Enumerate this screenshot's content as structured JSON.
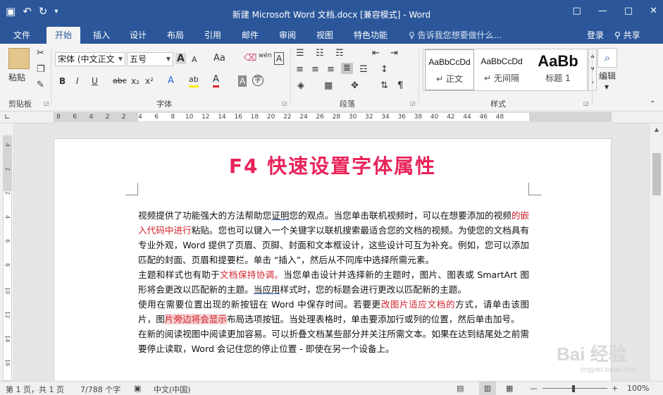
{
  "window": {
    "title": "新建 Microsoft Word 文档.docx [兼容模式] - Word",
    "controls": [
      "□",
      "—",
      "□",
      "✕"
    ]
  },
  "quick_access": {
    "save_icon": "▣",
    "undo_icon": "↶",
    "redo_icon": "↻",
    "customize_icon": "▾"
  },
  "tabs": [
    {
      "label": "文件"
    },
    {
      "label": "开始"
    },
    {
      "label": "插入"
    },
    {
      "label": "设计"
    },
    {
      "label": "布局"
    },
    {
      "label": "引用"
    },
    {
      "label": "邮件"
    },
    {
      "label": "审阅"
    },
    {
      "label": "视图"
    },
    {
      "label": "特色功能"
    }
  ],
  "active_tab": "开始",
  "tell_me": "♀ 告诉我您想要做什么...",
  "account": {
    "login": "登录",
    "share": "共享"
  },
  "ribbon": {
    "clipboard": {
      "paste": "粘贴",
      "label": "剪贴板"
    },
    "font": {
      "font_name": "宋体 (中文正文",
      "font_size": "五号",
      "grow": "A",
      "shrink": "A",
      "case": "Aa",
      "wen": "wén",
      "bold": "B",
      "italic": "I",
      "underline": "U",
      "strike": "abc",
      "subscript": "x₂",
      "superscript": "x²",
      "highlight": "ab",
      "font_color": "A",
      "shading": "A",
      "enclose": "字",
      "label": "字体"
    },
    "paragraph": {
      "label": "段落"
    },
    "styles": {
      "items": [
        {
          "sample": "AaBbCcDd",
          "name": "↵ 正文"
        },
        {
          "sample": "AaBbCcDd",
          "name": "↵ 无间隔"
        },
        {
          "sample": "AaBb",
          "name": "标题 1"
        }
      ],
      "label": "样式"
    },
    "editing": {
      "label": "编辑"
    }
  },
  "ruler": {
    "ticks": [
      "8",
      "6",
      "4",
      "2",
      "2",
      "4",
      "6",
      "8",
      "10",
      "12",
      "14",
      "16",
      "18",
      "20",
      "22",
      "24",
      "26",
      "28",
      "30",
      "32",
      "34",
      "36",
      "38",
      "40",
      "42",
      "44",
      "46",
      "48"
    ],
    "vticks": [
      "4",
      "2",
      "2",
      "4",
      "6",
      "8",
      "10",
      "12",
      "14",
      "16"
    ]
  },
  "document": {
    "heading": "F4  快速设置字体属性",
    "paragraphs": [
      [
        {
          "t": "视频提供了功能强大的方法帮助您"
        },
        {
          "t": "证明",
          "s": "uline"
        },
        {
          "t": "您的观点。当您单击联机视频时，可以在想要添加的视频"
        },
        {
          "t": "的嵌入代码中进行",
          "s": "red"
        },
        {
          "t": "粘贴。您也可以键入一个关键字以联机搜索最适合您的文档的视频。为使您的文档具有专业外观，Word 提供了页眉、页脚、封面和文本框设计，这些设计可互为补充。例如，您可以添加匹配的封面、页眉和提要栏。单击 “插入”，然后从不同库中选择所需元素。"
        }
      ],
      [
        {
          "t": "主题和样式也有助于"
        },
        {
          "t": "文档保持协调。",
          "s": "red"
        },
        {
          "t": "当您单击设计并选择新的主题时，图片、图表或 SmartArt 图形将会更改以匹配新的主题。"
        },
        {
          "t": "当应用",
          "s": "uline"
        },
        {
          "t": "样式时，您的标题会进行更改以匹配新的主题。"
        }
      ],
      [
        {
          "t": "使用在需要位置出现的新按钮在 Word 中保存时间。若要更"
        },
        {
          "t": "改图片适应文档的",
          "s": "red"
        },
        {
          "t": "方式，请单击该图片，图"
        },
        {
          "t": "片旁边将会显示",
          "s": "hl"
        },
        {
          "t": "布局选项按钮。当处理表格时，单击要添加行或列的位置，然后单击加号。"
        }
      ],
      [
        {
          "t": "在新的阅读视图中阅读更加容易。可以折叠文档某些部分并关注所需文本。如果在达到结尾处之前需要停止读取，Word 会记住您的停止位置 - 即使在另一个设备上。"
        }
      ]
    ]
  },
  "status": {
    "page": "第 1 页，共 1 页",
    "words": "7/788 个字",
    "language": "中文(中国)",
    "zoom_out": "—",
    "zoom_in": "+",
    "zoom": "100%"
  },
  "watermark": {
    "main": "Bai 经验",
    "sub": "jingyan.baidu.com"
  }
}
